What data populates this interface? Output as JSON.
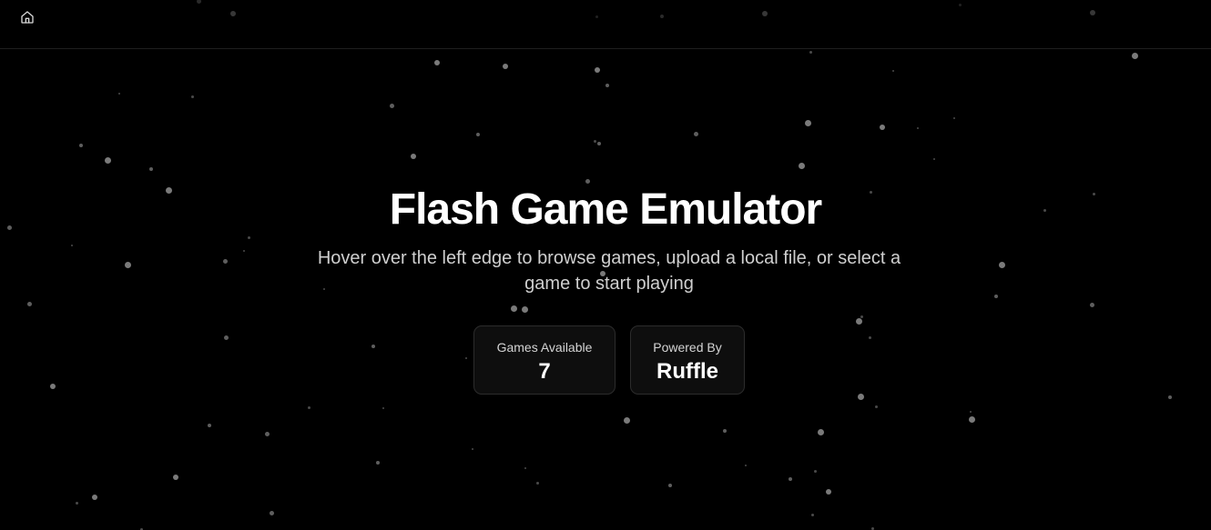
{
  "nav": {
    "home_icon": "home-icon"
  },
  "hero": {
    "title": "Flash Game Emulator",
    "subtitle": "Hover over the left edge to browse games, upload a local file, or select a game to start playing"
  },
  "stats": [
    {
      "label": "Games Available",
      "value": "7"
    },
    {
      "label": "Powered By",
      "value": "Ruffle"
    }
  ],
  "colors": {
    "background": "#000000",
    "text": "#ffffff",
    "muted_text": "#cfcfcf",
    "card_border": "#2c2c2c",
    "star": "#6f6f6f"
  }
}
